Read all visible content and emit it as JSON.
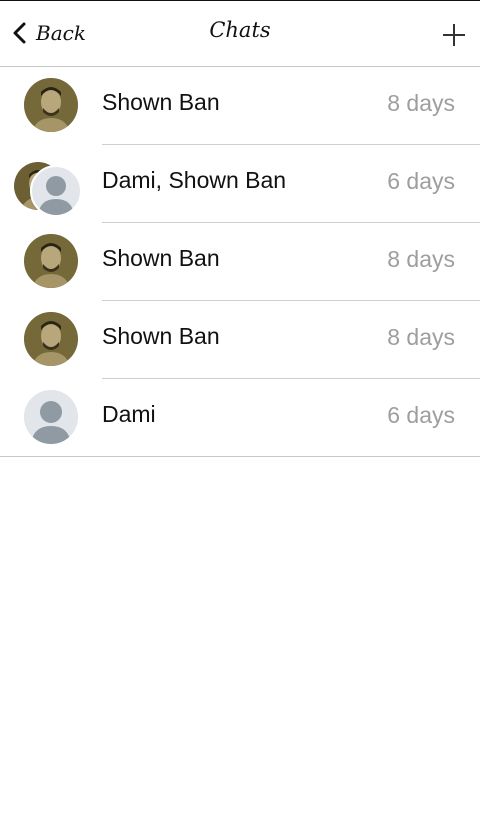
{
  "header": {
    "back_label": "Back",
    "title": "Chats",
    "add_icon": "plus-icon"
  },
  "chats": [
    {
      "name": "Shown Ban",
      "time": "8 days",
      "avatar": "photo"
    },
    {
      "name": "Dami, Shown Ban",
      "time": "6 days",
      "avatar": "group"
    },
    {
      "name": "Shown Ban",
      "time": "8 days",
      "avatar": "photo"
    },
    {
      "name": "Shown Ban",
      "time": "8 days",
      "avatar": "photo"
    },
    {
      "name": "Dami",
      "time": "6 days",
      "avatar": "default"
    }
  ],
  "colors": {
    "divider": "#cfcfcf",
    "time_text": "#9e9e9e",
    "avatar_default_bg": "#e2e6ea",
    "avatar_default_fg": "#8f9aa3",
    "photo_tone": "#6b5f33"
  }
}
